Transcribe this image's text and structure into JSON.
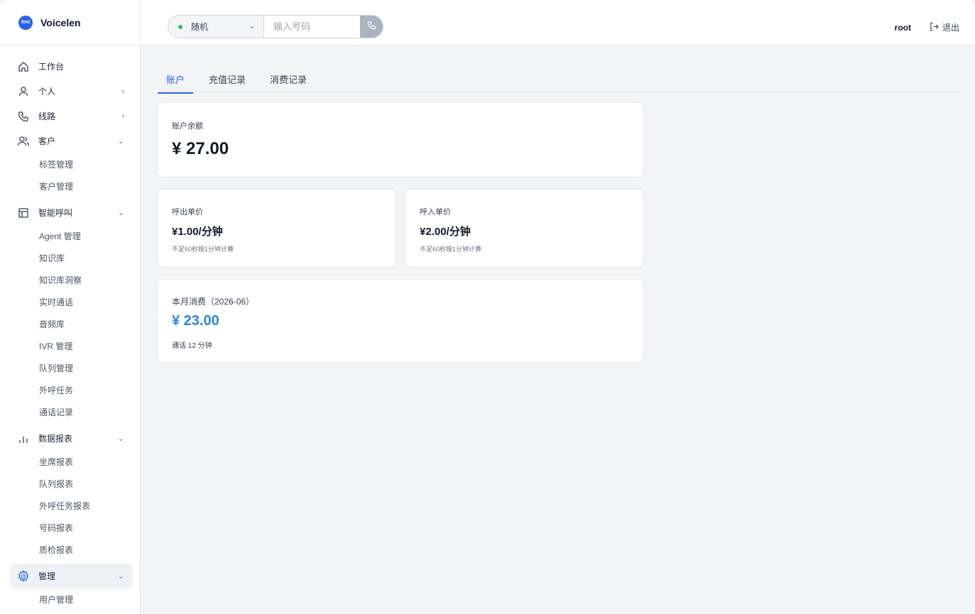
{
  "app": {
    "name": "Voicelen",
    "logo_text": "leni"
  },
  "sidebar": {
    "items": [
      {
        "label": "工作台",
        "icon": "home-icon"
      },
      {
        "label": "个人",
        "icon": "user-icon",
        "chevron": "›"
      },
      {
        "label": "线路",
        "icon": "phone-icon",
        "chevron": "›"
      },
      {
        "label": "客户",
        "icon": "users-icon",
        "chevron": "⌄",
        "children": [
          "标签管理",
          "客户管理"
        ]
      },
      {
        "label": "智能呼叫",
        "icon": "layout-icon",
        "chevron": "⌄",
        "children": [
          "Agent 管理",
          "知识库",
          "知识库洞察",
          "实时通话",
          "音频库",
          "IVR 管理",
          "队列管理",
          "外呼任务",
          "通话记录"
        ]
      },
      {
        "label": "数据报表",
        "icon": "bar-chart-icon",
        "chevron": "⌄",
        "children": [
          "坐席报表",
          "队列报表",
          "外呼任务报表",
          "号码报表",
          "质检报表"
        ]
      },
      {
        "label": "管理",
        "icon": "gear-icon",
        "chevron": "⌄",
        "children": [
          "用户管理"
        ]
      }
    ]
  },
  "topbar": {
    "line_select": "随机",
    "number_placeholder": "输入号码",
    "user": "root",
    "logout": "退出"
  },
  "tabs": [
    "账户",
    "充值记录",
    "消费记录"
  ],
  "account": {
    "balance_label": "账户余额",
    "balance": "¥ 27.00",
    "outbound_label": "呼出单价",
    "outbound_price": "¥1.00/分钟",
    "outbound_note": "不足60秒按1分钟计算",
    "inbound_label": "呼入单价",
    "inbound_price": "¥2.00/分钟",
    "inbound_note": "不足60秒按1分钟计算",
    "month_label": "本月消费（2026-06）",
    "month_value": "¥ 23.00",
    "month_note": "通话 12 分钟"
  },
  "colors": {
    "accent": "#2563eb",
    "month_value": "#2f86e6",
    "status_dot": "#22c55e"
  }
}
